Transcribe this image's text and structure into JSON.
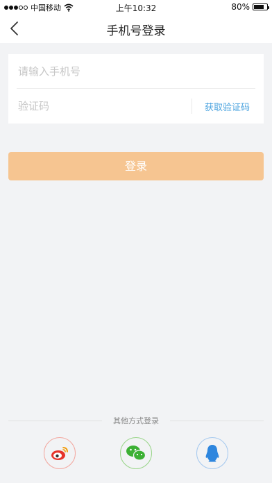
{
  "status_bar": {
    "carrier": "中国移动",
    "time": "上午10:32",
    "battery": "80%",
    "battery_level": 0.8
  },
  "nav": {
    "title": "手机号登录"
  },
  "form": {
    "phone_placeholder": "请输入手机号",
    "code_placeholder": "验证码",
    "get_code_label": "获取验证码"
  },
  "login_button": "登录",
  "other_login": {
    "label": "其他方式登录",
    "providers": [
      "weibo-icon",
      "wechat-icon",
      "qq-icon"
    ]
  },
  "colors": {
    "accent": "#f6c591",
    "link": "#4aa3df",
    "background": "#f2f3f5"
  }
}
